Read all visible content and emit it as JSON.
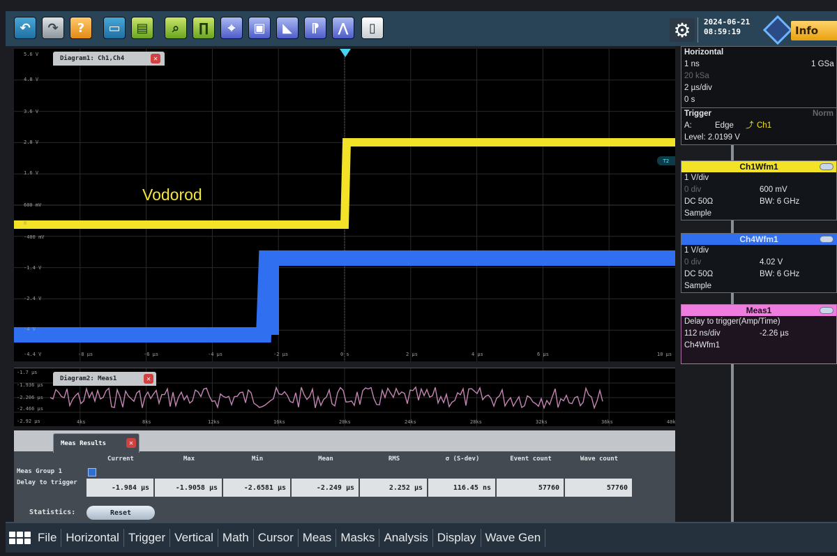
{
  "toolbar": {
    "buttons": [
      {
        "name": "undo-icon",
        "style": "blue",
        "glyph": "↶"
      },
      {
        "name": "redo-icon",
        "style": "grey",
        "glyph": "↷"
      },
      {
        "name": "help-icon",
        "style": "orange",
        "glyph": "?"
      },
      {
        "name": "open-folder-icon",
        "style": "blue",
        "glyph": "▭"
      },
      {
        "name": "save-icon",
        "style": "green",
        "glyph": "▤"
      },
      {
        "name": "zoom-icon",
        "style": "green",
        "glyph": "⌕"
      },
      {
        "name": "probe-icon",
        "style": "green",
        "glyph": "∏"
      },
      {
        "name": "cursor-icon",
        "style": "violet",
        "glyph": "⌖"
      },
      {
        "name": "zoom-window-icon",
        "style": "violet",
        "glyph": "▣"
      },
      {
        "name": "measure-icon",
        "style": "violet",
        "glyph": "◣"
      },
      {
        "name": "marker-icon",
        "style": "violet",
        "glyph": "⁋"
      },
      {
        "name": "fft-icon",
        "style": "violet",
        "glyph": "⋀"
      },
      {
        "name": "delete-icon",
        "style": "white",
        "glyph": "▯"
      }
    ],
    "date": "2024-06-21",
    "time": "08:59:19",
    "info_label": "Info"
  },
  "diagram1": {
    "tab_label": "Diagram1: Ch1,Ch4",
    "overlay_text": "Vodorod",
    "y_labels": [
      "5.6 V",
      "4.8 V",
      "3.6 V",
      "2.8 V",
      "1.6 V",
      "600 mV",
      "0",
      "-400 mV",
      "-1.4 V",
      "-2.4 V",
      "-4 V",
      "-4.4 V"
    ],
    "x_labels": [
      "-8 µs",
      "-6 µs",
      "-4 µs",
      "-2 µs",
      "0 s",
      "2 µs",
      "4 µs",
      "6 µs",
      "10 µs"
    ],
    "trigger_marker_label": "T2"
  },
  "diagram2": {
    "tab_label": "Diagram2: Meas1",
    "y_labels": [
      "-1.7 µs",
      "-1.936 µs",
      "-2.206 µs",
      "-2.466 µs",
      "-2.92 µs"
    ],
    "x_labels": [
      "4ks",
      "8ks",
      "12ks",
      "16ks",
      "20ks",
      "24ks",
      "28ks",
      "32ks",
      "36ks",
      "40ks"
    ]
  },
  "meas_results": {
    "tab_label": "Meas Results",
    "columns": [
      "Current",
      "Max",
      "Min",
      "Mean",
      "RMS",
      "σ (S-dev)",
      "Event count",
      "Wave count"
    ],
    "group_label": "Meas Group 1",
    "row_label": "Delay to trigger",
    "values": [
      "-1.984 µs",
      "-1.9058 µs",
      "-2.6581 µs",
      "-2.249 µs",
      "2.252 µs",
      "116.45 ns",
      "57760",
      "57760"
    ],
    "stats_label": "Statistics:",
    "reset_label": "Reset"
  },
  "side": {
    "horizontal": {
      "title": "Horizontal",
      "resolution": "1 ns",
      "sample_rate": "1 GSa",
      "record": "20 kSa",
      "time_scale": "2 µs/div",
      "position": "0 s"
    },
    "trigger": {
      "title": "Trigger",
      "mode": "Norm",
      "line_a": "A:",
      "type": "Edge",
      "source": "Ch1",
      "level": "Level: 2.0199 V"
    },
    "ch1": {
      "title": "Ch1Wfm1",
      "scale": "1 V/div",
      "offset_div": "0 div",
      "offset": "600 mV",
      "coupling": "DC 50Ω",
      "bw": "BW: 6 GHz",
      "mode": "Sample",
      "color": "#f2e228"
    },
    "ch4": {
      "title": "Ch4Wfm1",
      "scale": "1 V/div",
      "offset_div": "0 div",
      "offset": "4.02 V",
      "coupling": "DC 50Ω",
      "bw": "BW: 6 GHz",
      "mode": "Sample",
      "color": "#2f6ff0"
    },
    "meas1": {
      "title": "Meas1",
      "line1": "Delay to trigger(Amp/Time)",
      "scale": "112 ns/div",
      "value": "-2.26 µs",
      "source": "Ch4Wfm1",
      "color": "#f07ce0"
    }
  },
  "menubar": {
    "items": [
      "File",
      "Horizontal",
      "Trigger",
      "Vertical",
      "Math",
      "Cursor",
      "Meas",
      "Masks",
      "Analysis",
      "Display",
      "Wave Gen"
    ]
  }
}
